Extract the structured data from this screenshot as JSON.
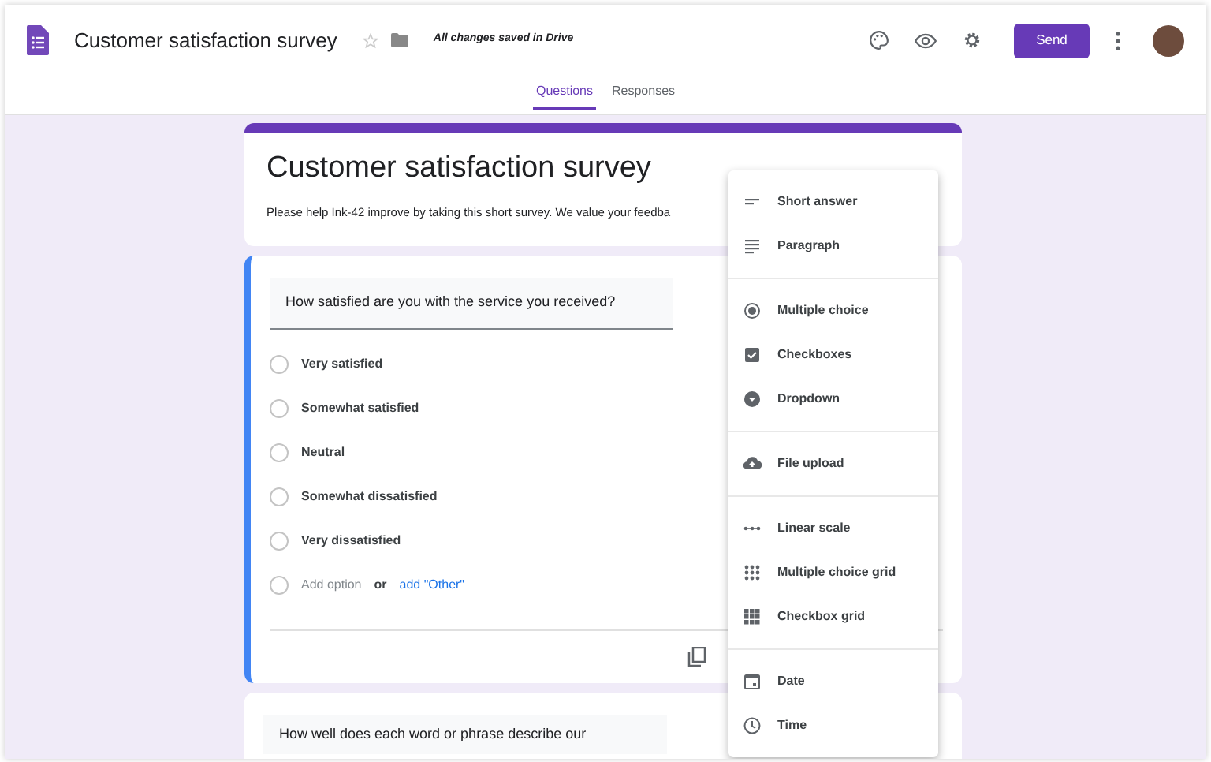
{
  "header": {
    "title": "Customer satisfaction survey",
    "save_status": "All changes saved in Drive",
    "send": "Send"
  },
  "tabs": [
    {
      "label": "Questions",
      "selected": true
    },
    {
      "label": "Responses",
      "selected": false
    }
  ],
  "form": {
    "title": "Customer satisfaction survey",
    "description": "Please help Ink-42 improve by taking this short survey. We value your feedba"
  },
  "question": {
    "text": "How satisfied are you with the service you received?",
    "options": [
      {
        "label": "Very satisfied",
        "selected": false
      },
      {
        "label": "Somewhat satisfied",
        "selected": false
      },
      {
        "label": "Neutral",
        "selected": false
      },
      {
        "label": "Somewhat dissatisfied",
        "selected": false
      },
      {
        "label": "Very dissatisfied",
        "selected": false
      }
    ],
    "add_option": "Add option",
    "add_option_selected": false,
    "or": "or",
    "add_other": "add \"Other\""
  },
  "next_question": {
    "text": "How well does each word or phrase describe our"
  },
  "type_menu": {
    "groups": [
      [
        {
          "kind": "short",
          "label": "Short answer"
        },
        {
          "kind": "paragraph",
          "label": "Paragraph"
        }
      ],
      [
        {
          "kind": "radio",
          "label": "Multiple choice"
        },
        {
          "kind": "checkbox",
          "label": "Checkboxes"
        },
        {
          "kind": "dropdown",
          "label": "Dropdown"
        }
      ],
      [
        {
          "kind": "upload",
          "label": "File upload"
        }
      ],
      [
        {
          "kind": "scale",
          "label": "Linear scale"
        },
        {
          "kind": "radiogrid",
          "label": "Multiple choice grid"
        },
        {
          "kind": "checkgrid",
          "label": "Checkbox grid"
        }
      ],
      [
        {
          "kind": "date",
          "label": "Date"
        },
        {
          "kind": "time",
          "label": "Time"
        }
      ]
    ]
  }
}
